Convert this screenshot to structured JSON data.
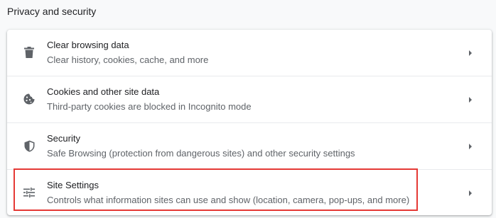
{
  "section": {
    "title": "Privacy and security"
  },
  "items": [
    {
      "label": "Clear browsing data",
      "sub": "Clear history, cookies, cache, and more",
      "icon": "trash-icon"
    },
    {
      "label": "Cookies and other site data",
      "sub": "Third-party cookies are blocked in Incognito mode",
      "icon": "cookie-icon"
    },
    {
      "label": "Security",
      "sub": "Safe Browsing (protection from dangerous sites) and other security settings",
      "icon": "shield-icon"
    },
    {
      "label": "Site Settings",
      "sub": "Controls what information sites can use and show (location, camera, pop-ups, and more)",
      "icon": "sliders-icon"
    }
  ],
  "colors": {
    "accent_highlight": "#e53935",
    "icon": "#5f6368",
    "background": "#f8f9fa"
  }
}
